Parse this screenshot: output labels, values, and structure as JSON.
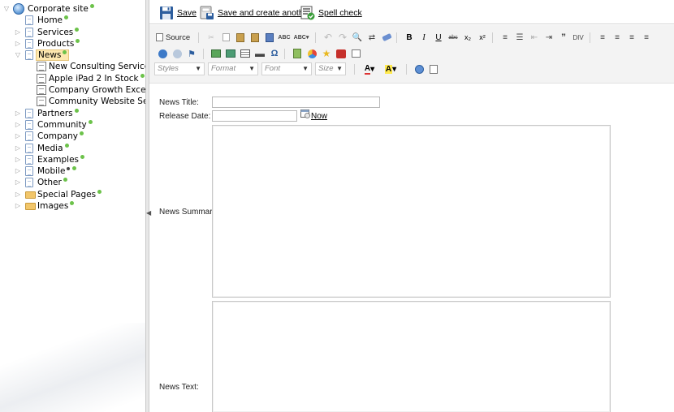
{
  "tree": {
    "root": {
      "label": "Corporate site"
    },
    "items": [
      {
        "label": "Home",
        "level": 1,
        "icon": "doc",
        "expand": "none"
      },
      {
        "label": "Services",
        "level": 1,
        "icon": "doc",
        "expand": "collapsed"
      },
      {
        "label": "Products",
        "level": 1,
        "icon": "doc",
        "expand": "collapsed"
      },
      {
        "label": "News",
        "level": 1,
        "icon": "doc",
        "expand": "expanded",
        "selected": true
      },
      {
        "label": "New Consulting Services",
        "level": 2,
        "icon": "news",
        "expand": "none"
      },
      {
        "label": "Apple iPad 2 In Stock",
        "level": 2,
        "icon": "news",
        "expand": "none"
      },
      {
        "label": "Company Growth Exceeds E",
        "level": 2,
        "icon": "news",
        "expand": "none",
        "nodot": true
      },
      {
        "label": "Community Website Section",
        "level": 2,
        "icon": "news",
        "expand": "none",
        "nodot": true
      },
      {
        "label": "Partners",
        "level": 1,
        "icon": "doc",
        "expand": "collapsed"
      },
      {
        "label": "Community",
        "level": 1,
        "icon": "doc",
        "expand": "collapsed"
      },
      {
        "label": "Company",
        "level": 1,
        "icon": "doc",
        "expand": "collapsed"
      },
      {
        "label": "Media",
        "level": 1,
        "icon": "doc",
        "expand": "collapsed"
      },
      {
        "label": "Examples",
        "level": 1,
        "icon": "doc",
        "expand": "collapsed"
      },
      {
        "label": "Mobile",
        "level": 1,
        "icon": "doc",
        "expand": "collapsed",
        "mobile": true
      },
      {
        "label": "Other",
        "level": 1,
        "icon": "doc",
        "expand": "collapsed"
      },
      {
        "label": "Special Pages",
        "level": 1,
        "icon": "folder",
        "expand": "collapsed"
      },
      {
        "label": "Images",
        "level": 1,
        "icon": "folder",
        "expand": "collapsed"
      }
    ]
  },
  "actions": {
    "save": "Save",
    "save_create": "Save and create another",
    "spell_check": "Spell check"
  },
  "editor_toolbar": {
    "source": "Source",
    "styles": "Styles",
    "format": "Format",
    "font": "Font",
    "size": "Size"
  },
  "form": {
    "title_label": "News Title:",
    "title_value": "",
    "release_label": "Release Date:",
    "release_value": "",
    "now_link": "Now",
    "summary_label": "News Summary:",
    "text_label": "News Text:"
  },
  "colors": {
    "status_dot": "#6cc24a",
    "selection": "#fde8b0"
  }
}
